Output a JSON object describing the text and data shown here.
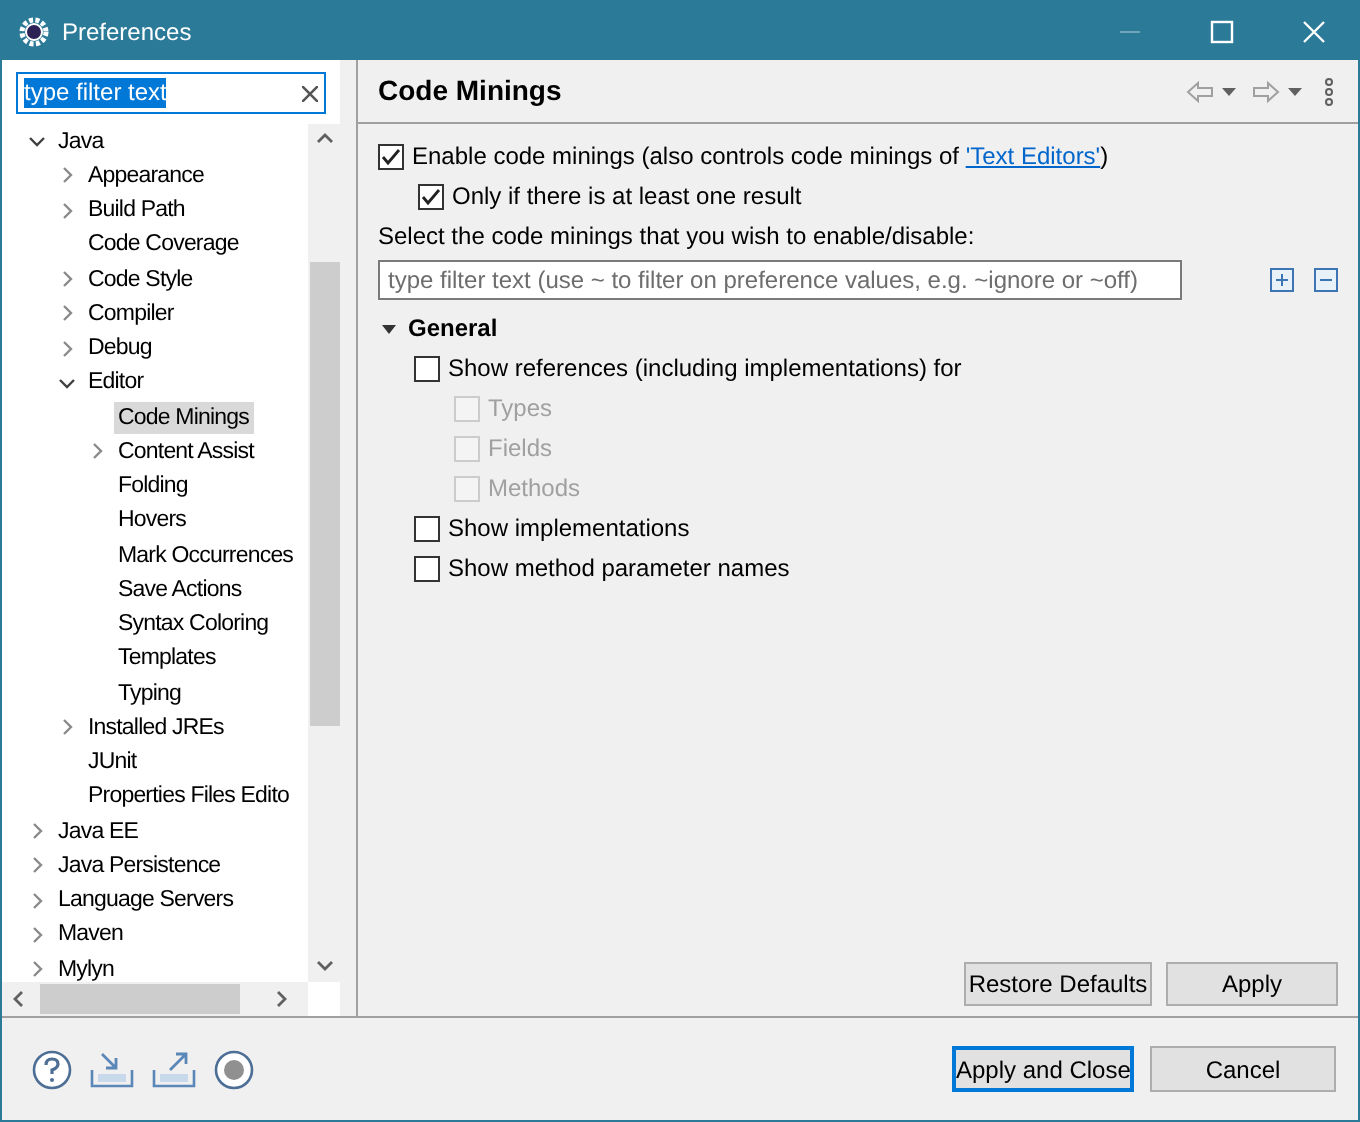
{
  "window": {
    "title": "Preferences"
  },
  "filter": {
    "value": "type filter text"
  },
  "tree": [
    {
      "label": "Java",
      "expanded": true,
      "selected": false,
      "children": [
        {
          "label": "Appearance",
          "expanded": false,
          "selected": false
        },
        {
          "label": "Build Path",
          "expanded": false,
          "selected": false
        },
        {
          "label": "Code Coverage",
          "selected": false
        },
        {
          "label": "Code Style",
          "expanded": false,
          "selected": false
        },
        {
          "label": "Compiler",
          "expanded": false,
          "selected": false
        },
        {
          "label": "Debug",
          "expanded": false,
          "selected": false
        },
        {
          "label": "Editor",
          "expanded": true,
          "selected": false,
          "children": [
            {
              "label": "Code Minings",
              "selected": true
            },
            {
              "label": "Content Assist",
              "expanded": false,
              "selected": false
            },
            {
              "label": "Folding",
              "selected": false
            },
            {
              "label": "Hovers",
              "selected": false
            },
            {
              "label": "Mark Occurrences",
              "selected": false
            },
            {
              "label": "Save Actions",
              "selected": false
            },
            {
              "label": "Syntax Coloring",
              "selected": false
            },
            {
              "label": "Templates",
              "selected": false
            },
            {
              "label": "Typing",
              "selected": false
            }
          ]
        },
        {
          "label": "Installed JREs",
          "expanded": false,
          "selected": false
        },
        {
          "label": "JUnit",
          "selected": false
        },
        {
          "label": "Properties Files Edito",
          "selected": false
        }
      ]
    },
    {
      "label": "Java EE",
      "expanded": false,
      "selected": false
    },
    {
      "label": "Java Persistence",
      "expanded": false,
      "selected": false
    },
    {
      "label": "Language Servers",
      "expanded": false,
      "selected": false
    },
    {
      "label": "Maven",
      "expanded": false,
      "selected": false
    },
    {
      "label": "Mylyn",
      "expanded": false,
      "selected": false
    }
  ],
  "page": {
    "title": "Code Minings",
    "options": [
      {
        "label": "Enable code minings (also controls code minings of ",
        "link": "'Text Editors'",
        "label_end": ")",
        "checked": true,
        "children": [
          {
            "label": "Only if there is at least one result",
            "checked": true
          }
        ]
      }
    ],
    "hint": "Select the code minings that you wish to enable/disable:",
    "search": {
      "placeholder": "type filter text (use ~ to filter on preference values, e.g. ~ignore or ~off)"
    },
    "sections": [
      {
        "title": "General",
        "expanded": true,
        "items": [
          {
            "label": "Show references (including implementations) for",
            "checked": false,
            "disabled": false,
            "children": [
              {
                "label": "Types",
                "checked": false,
                "disabled": true
              },
              {
                "label": "Fields",
                "checked": false,
                "disabled": true
              },
              {
                "label": "Methods",
                "checked": false,
                "disabled": true
              }
            ]
          },
          {
            "label": "Show implementations",
            "checked": false,
            "disabled": false
          },
          {
            "label": "Show method parameter names",
            "checked": false,
            "disabled": false
          }
        ]
      }
    ],
    "buttons": [
      {
        "label": "Restore Defaults"
      },
      {
        "label": "Apply"
      }
    ]
  },
  "dialog_buttons": [
    {
      "label": "Apply and Close",
      "default": true
    },
    {
      "label": "Cancel",
      "default": false
    }
  ]
}
